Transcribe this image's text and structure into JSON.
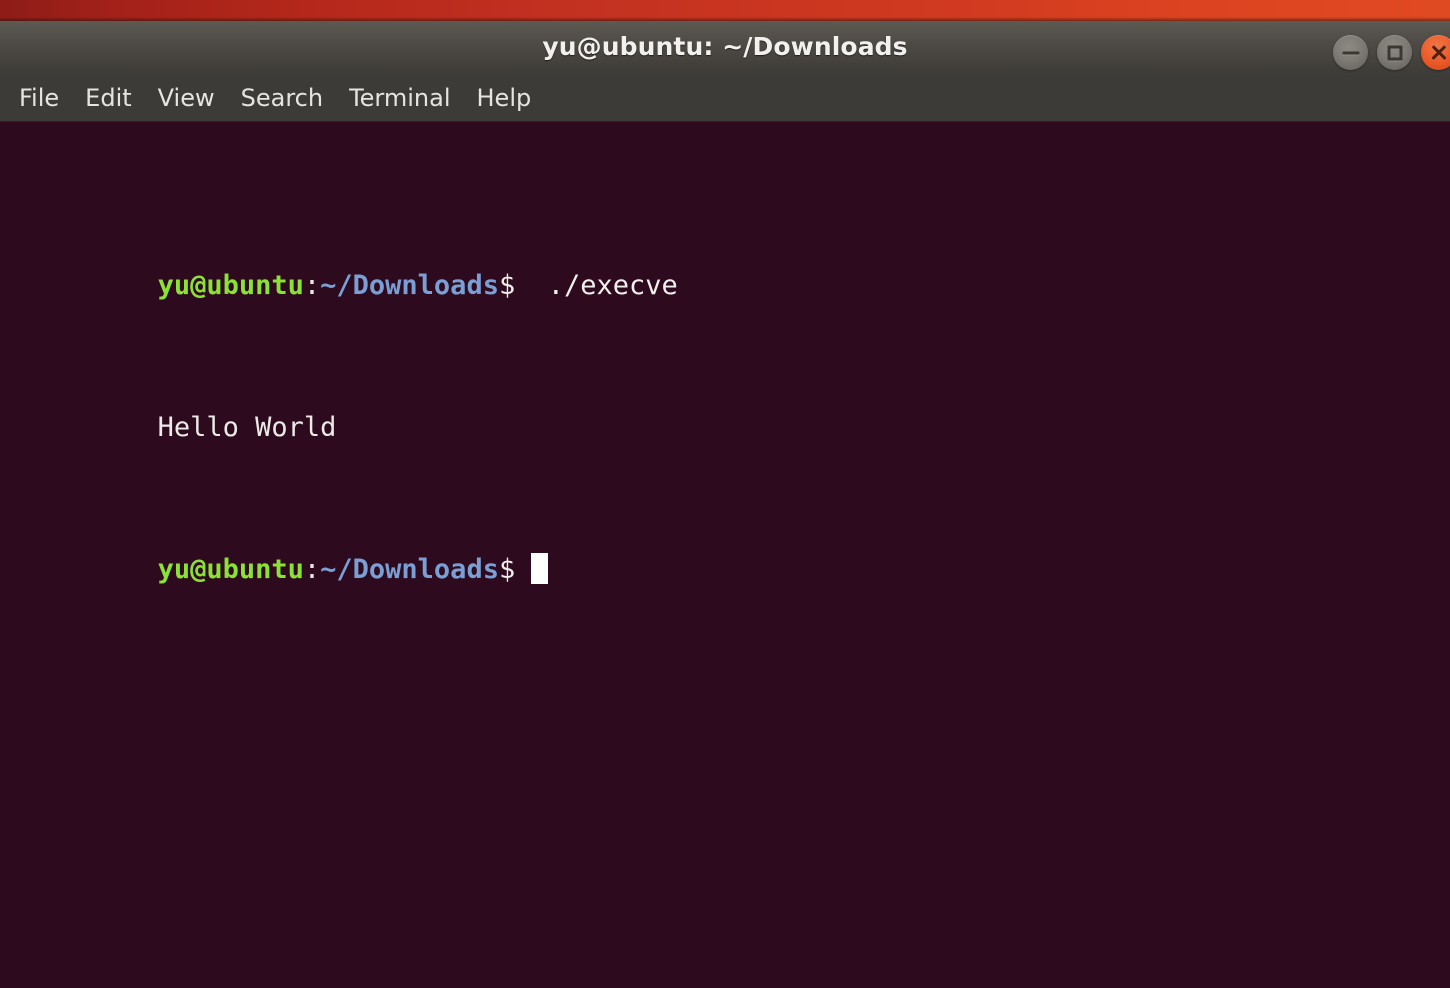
{
  "desktop": {
    "strip_color_left": "#8e1c18",
    "strip_color_right": "#e04a22"
  },
  "window": {
    "title": "yu@ubuntu: ~/Downloads",
    "titlebar_color": "#4e4b46",
    "controls": [
      {
        "name": "minimize",
        "label": "–"
      },
      {
        "name": "maximize",
        "label": "□"
      },
      {
        "name": "close",
        "label": "✕"
      }
    ]
  },
  "menubar": {
    "items": [
      {
        "label": "File"
      },
      {
        "label": "Edit"
      },
      {
        "label": "View"
      },
      {
        "label": "Search"
      },
      {
        "label": "Terminal"
      },
      {
        "label": "Help"
      }
    ]
  },
  "terminal": {
    "background_color": "#2d0a1e",
    "prompt_user_color": "#8ae234",
    "prompt_path_color": "#7a9fd4",
    "text_color": "#eceae6",
    "cursor_color": "#ffffff",
    "lines": [
      {
        "type": "prompt",
        "user": "yu@ubuntu",
        "colon": ":",
        "path": "~/Downloads",
        "sigil": "$",
        "space": " ",
        "command": "./execve"
      },
      {
        "type": "output",
        "text": "Hello World"
      },
      {
        "type": "prompt",
        "user": "yu@ubuntu",
        "colon": ":",
        "path": "~/Downloads",
        "sigil": "$",
        "space": " ",
        "command": ""
      }
    ]
  }
}
